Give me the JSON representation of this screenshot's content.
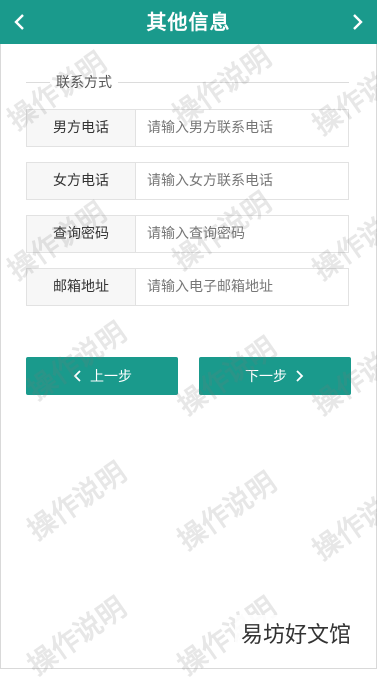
{
  "header": {
    "title": "其他信息",
    "back_icon": "chevron-left-icon",
    "forward_icon": "chevron-right-icon"
  },
  "section": {
    "legend": "联系方式"
  },
  "form": {
    "fields": [
      {
        "label": "男方电话",
        "placeholder": "请输入男方联系电话"
      },
      {
        "label": "女方电话",
        "placeholder": "请输入女方联系电话"
      },
      {
        "label": "查询密码",
        "placeholder": "请输入查询密码"
      },
      {
        "label": "邮箱地址",
        "placeholder": "请输入电子邮箱地址"
      }
    ]
  },
  "buttons": {
    "prev_label": "上一步",
    "next_label": "下一步"
  },
  "watermark_text": "操作说明",
  "source_tag": "易坊好文馆",
  "colors": {
    "accent": "#1a9a8c",
    "label_bg": "#f7f7f7",
    "border": "#e2e2e2"
  }
}
